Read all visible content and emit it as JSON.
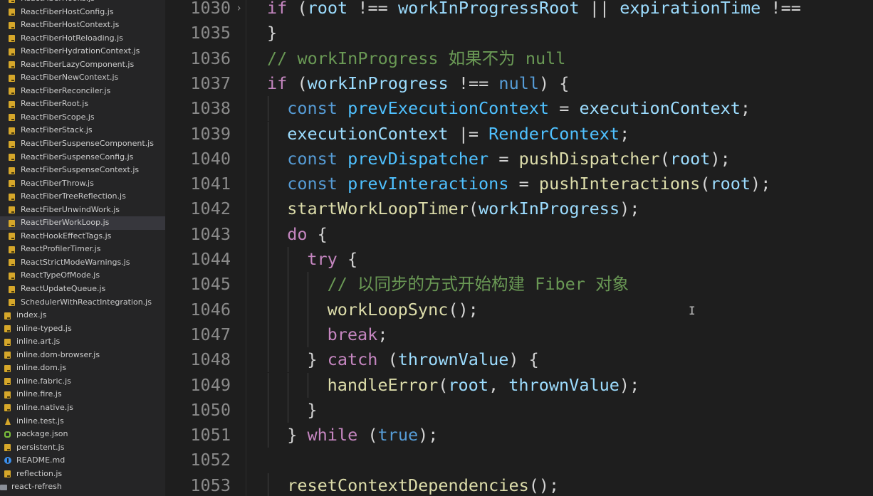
{
  "sidebar": {
    "files": [
      {
        "name": "ReactFiberHooks.js",
        "icon": "js-file-icon",
        "indent": 1
      },
      {
        "name": "ReactFiberHostConfig.js",
        "icon": "js-file-icon",
        "indent": 1
      },
      {
        "name": "ReactFiberHostContext.js",
        "icon": "js-file-icon",
        "indent": 1
      },
      {
        "name": "ReactFiberHotReloading.js",
        "icon": "js-file-icon",
        "indent": 1
      },
      {
        "name": "ReactFiberHydrationContext.js",
        "icon": "js-file-icon",
        "indent": 1
      },
      {
        "name": "ReactFiberLazyComponent.js",
        "icon": "js-file-icon",
        "indent": 1
      },
      {
        "name": "ReactFiberNewContext.js",
        "icon": "js-file-icon",
        "indent": 1
      },
      {
        "name": "ReactFiberReconciler.js",
        "icon": "js-file-icon",
        "indent": 1
      },
      {
        "name": "ReactFiberRoot.js",
        "icon": "js-file-icon",
        "indent": 1
      },
      {
        "name": "ReactFiberScope.js",
        "icon": "js-file-icon",
        "indent": 1
      },
      {
        "name": "ReactFiberStack.js",
        "icon": "js-file-icon",
        "indent": 1
      },
      {
        "name": "ReactFiberSuspenseComponent.js",
        "icon": "js-file-icon",
        "indent": 1
      },
      {
        "name": "ReactFiberSuspenseConfig.js",
        "icon": "js-file-icon",
        "indent": 1
      },
      {
        "name": "ReactFiberSuspenseContext.js",
        "icon": "js-file-icon",
        "indent": 1
      },
      {
        "name": "ReactFiberThrow.js",
        "icon": "js-file-icon",
        "indent": 1
      },
      {
        "name": "ReactFiberTreeReflection.js",
        "icon": "js-file-icon",
        "indent": 1
      },
      {
        "name": "ReactFiberUnwindWork.js",
        "icon": "js-file-icon",
        "indent": 1
      },
      {
        "name": "ReactFiberWorkLoop.js",
        "icon": "js-file-icon",
        "indent": 1,
        "active": true
      },
      {
        "name": "ReactHookEffectTags.js",
        "icon": "js-file-icon",
        "indent": 1
      },
      {
        "name": "ReactProfilerTimer.js",
        "icon": "js-file-icon",
        "indent": 1
      },
      {
        "name": "ReactStrictModeWarnings.js",
        "icon": "js-file-icon",
        "indent": 1
      },
      {
        "name": "ReactTypeOfMode.js",
        "icon": "js-file-icon",
        "indent": 1
      },
      {
        "name": "ReactUpdateQueue.js",
        "icon": "js-file-icon",
        "indent": 1
      },
      {
        "name": "SchedulerWithReactIntegration.js",
        "icon": "js-file-icon",
        "indent": 1
      },
      {
        "name": "index.js",
        "icon": "js-file-icon",
        "indent": 0
      },
      {
        "name": "inline-typed.js",
        "icon": "js-file-icon",
        "indent": 0
      },
      {
        "name": "inline.art.js",
        "icon": "js-file-icon",
        "indent": 0
      },
      {
        "name": "inline.dom-browser.js",
        "icon": "js-file-icon",
        "indent": 0
      },
      {
        "name": "inline.dom.js",
        "icon": "js-file-icon",
        "indent": 0
      },
      {
        "name": "inline.fabric.js",
        "icon": "js-file-icon",
        "indent": 0
      },
      {
        "name": "inline.fire.js",
        "icon": "js-file-icon",
        "indent": 0
      },
      {
        "name": "inline.native.js",
        "icon": "js-file-icon",
        "indent": 0
      },
      {
        "name": "inline.test.js",
        "icon": "test-file-icon",
        "indent": 0
      },
      {
        "name": "package.json",
        "icon": "json-file-icon",
        "indent": 0
      },
      {
        "name": "persistent.js",
        "icon": "js-file-icon",
        "indent": 0
      },
      {
        "name": "README.md",
        "icon": "info-file-icon",
        "indent": 0
      },
      {
        "name": "reflection.js",
        "icon": "js-file-icon",
        "indent": 0
      },
      {
        "name": "react-refresh",
        "icon": "folder-icon",
        "indent": -1
      }
    ]
  },
  "editor": {
    "lines": [
      {
        "num": "1030",
        "fold": true,
        "indent": 0,
        "tokens": [
          [
            "kw",
            "if"
          ],
          [
            "pn",
            " ("
          ],
          [
            "id",
            "root"
          ],
          [
            "pn",
            " !== "
          ],
          [
            "id",
            "workInProgressRoot"
          ],
          [
            "pn",
            " || "
          ],
          [
            "id",
            "expirationTime"
          ],
          [
            "pn",
            " !=="
          ]
        ]
      },
      {
        "num": "1035",
        "indent": 0,
        "tokens": [
          [
            "pn",
            "}"
          ]
        ]
      },
      {
        "num": "1036",
        "indent": 0,
        "tokens": [
          [
            "cm",
            "// workInProgress 如果不为 null"
          ]
        ]
      },
      {
        "num": "1037",
        "indent": 0,
        "tokens": [
          [
            "kw",
            "if"
          ],
          [
            "pn",
            " ("
          ],
          [
            "id",
            "workInProgress"
          ],
          [
            "pn",
            " !== "
          ],
          [
            "kwb",
            "null"
          ],
          [
            "pn",
            ") {"
          ]
        ]
      },
      {
        "num": "1038",
        "indent": 1,
        "tokens": [
          [
            "kwb",
            "const"
          ],
          [
            "pn",
            " "
          ],
          [
            "cn",
            "prevExecutionContext"
          ],
          [
            "pn",
            " = "
          ],
          [
            "id",
            "executionContext"
          ],
          [
            "pn",
            ";"
          ]
        ]
      },
      {
        "num": "1039",
        "indent": 1,
        "tokens": [
          [
            "id",
            "executionContext"
          ],
          [
            "pn",
            " |= "
          ],
          [
            "cn",
            "RenderContext"
          ],
          [
            "pn",
            ";"
          ]
        ]
      },
      {
        "num": "1040",
        "indent": 1,
        "tokens": [
          [
            "kwb",
            "const"
          ],
          [
            "pn",
            " "
          ],
          [
            "cn",
            "prevDispatcher"
          ],
          [
            "pn",
            " = "
          ],
          [
            "fn",
            "pushDispatcher"
          ],
          [
            "pn",
            "("
          ],
          [
            "id",
            "root"
          ],
          [
            "pn",
            ");"
          ]
        ]
      },
      {
        "num": "1041",
        "indent": 1,
        "tokens": [
          [
            "kwb",
            "const"
          ],
          [
            "pn",
            " "
          ],
          [
            "cn",
            "prevInteractions"
          ],
          [
            "pn",
            " = "
          ],
          [
            "fn",
            "pushInteractions"
          ],
          [
            "pn",
            "("
          ],
          [
            "id",
            "root"
          ],
          [
            "pn",
            ");"
          ]
        ]
      },
      {
        "num": "1042",
        "indent": 1,
        "tokens": [
          [
            "fn",
            "startWorkLoopTimer"
          ],
          [
            "pn",
            "("
          ],
          [
            "id",
            "workInProgress"
          ],
          [
            "pn",
            ");"
          ]
        ]
      },
      {
        "num": "1043",
        "indent": 1,
        "tokens": [
          [
            "kw",
            "do"
          ],
          [
            "pn",
            " {"
          ]
        ]
      },
      {
        "num": "1044",
        "indent": 2,
        "tokens": [
          [
            "kw",
            "try"
          ],
          [
            "pn",
            " {"
          ]
        ]
      },
      {
        "num": "1045",
        "indent": 3,
        "tokens": [
          [
            "cm",
            "// 以同步的方式开始构建 Fiber 对象"
          ]
        ]
      },
      {
        "num": "1046",
        "indent": 3,
        "tokens": [
          [
            "fn",
            "workLoopSync"
          ],
          [
            "pn",
            "();"
          ]
        ]
      },
      {
        "num": "1047",
        "indent": 3,
        "tokens": [
          [
            "kw",
            "break"
          ],
          [
            "pn",
            ";"
          ]
        ]
      },
      {
        "num": "1048",
        "indent": 2,
        "tokens": [
          [
            "pn",
            "} "
          ],
          [
            "kw",
            "catch"
          ],
          [
            "pn",
            " ("
          ],
          [
            "id",
            "thrownValue"
          ],
          [
            "pn",
            ") {"
          ]
        ]
      },
      {
        "num": "1049",
        "indent": 3,
        "tokens": [
          [
            "fn",
            "handleError"
          ],
          [
            "pn",
            "("
          ],
          [
            "id",
            "root"
          ],
          [
            "pn",
            ", "
          ],
          [
            "id",
            "thrownValue"
          ],
          [
            "pn",
            ");"
          ]
        ]
      },
      {
        "num": "1050",
        "indent": 2,
        "tokens": [
          [
            "pn",
            "}"
          ]
        ]
      },
      {
        "num": "1051",
        "indent": 1,
        "tokens": [
          [
            "pn",
            "} "
          ],
          [
            "kw",
            "while"
          ],
          [
            "pn",
            " ("
          ],
          [
            "kwb",
            "true"
          ],
          [
            "pn",
            ");"
          ]
        ]
      },
      {
        "num": "1052",
        "indent": 0,
        "tokens": []
      },
      {
        "num": "1053",
        "indent": 1,
        "tokens": [
          [
            "fn",
            "resetContextDependencies"
          ],
          [
            "pn",
            "();"
          ]
        ]
      }
    ]
  }
}
